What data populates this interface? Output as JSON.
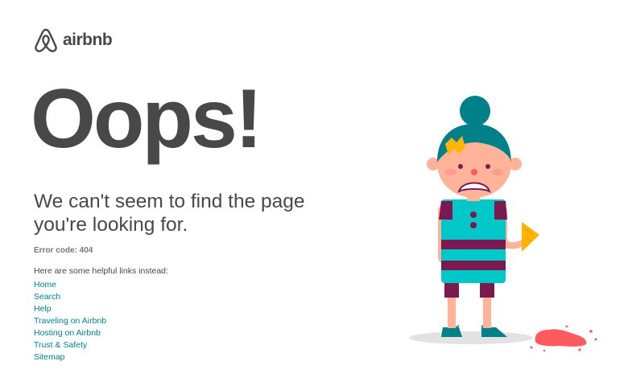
{
  "brand": {
    "name": "airbnb",
    "color": "#484848",
    "icon": "airbnb-belo-icon"
  },
  "page": {
    "headline": "Oops!",
    "subheadline": "We can't seem to find the page you're looking for.",
    "error_code": "Error code: 404",
    "helpful_intro": "Here are some helpful links instead:",
    "links": [
      {
        "label": "Home"
      },
      {
        "label": "Search"
      },
      {
        "label": "Help"
      },
      {
        "label": "Traveling on Airbnb"
      },
      {
        "label": "Hosting on Airbnb"
      },
      {
        "label": "Trust & Safety"
      },
      {
        "label": "Sitemap"
      }
    ],
    "link_color": "#008489"
  },
  "illustration": {
    "name": "girl-dropped-ice-cream-illustration",
    "colors": {
      "hair": "#00808A",
      "dress": "#00C8C8",
      "stripes": "#7A1A50",
      "skin": "#FFB49A",
      "ice_cream": "#FF5A5F",
      "cone": "#FFB400"
    }
  }
}
